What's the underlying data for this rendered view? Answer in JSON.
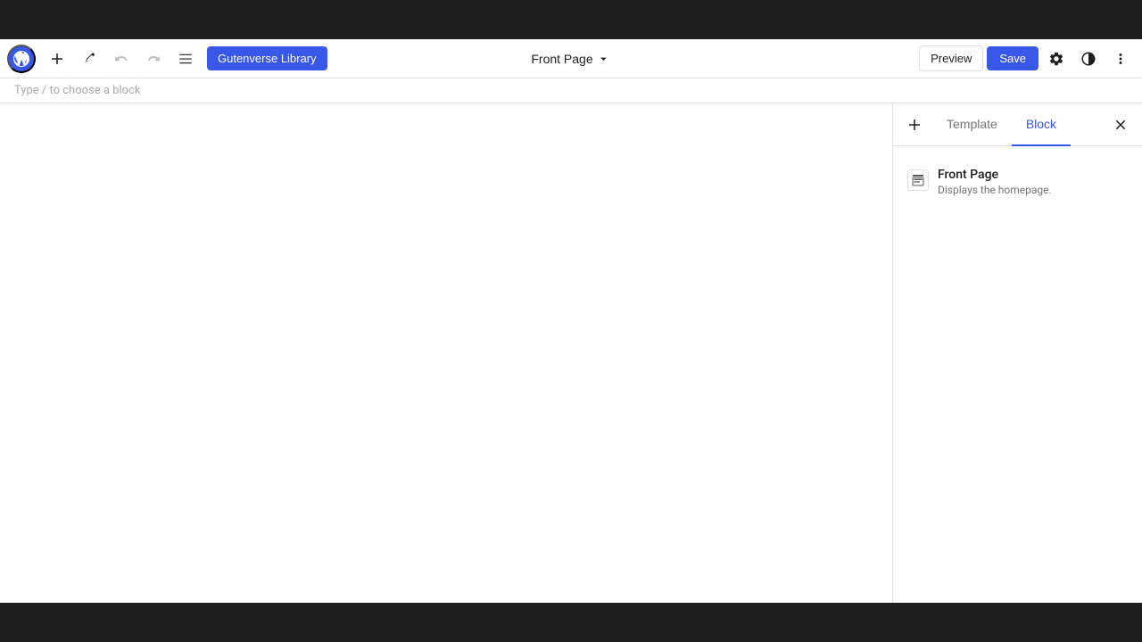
{
  "topBar": {
    "bg": "#1e1e1e"
  },
  "toolbar": {
    "wpLogo": "wordpress-logo",
    "addLabel": "+",
    "editLabel": "✏",
    "undoLabel": "↩",
    "redoLabel": "↪",
    "listLabel": "≡",
    "gutenverseLabel": "Gutenverse Library",
    "pageTitle": "Front Page",
    "previewLabel": "Preview",
    "saveLabel": "Save"
  },
  "hintBar": {
    "placeholder": "Type / to choose a block"
  },
  "sidebar": {
    "addLabel": "+",
    "tabs": [
      {
        "label": "Template",
        "active": false
      },
      {
        "label": "Block",
        "active": true
      }
    ],
    "closeLabel": "×",
    "template": {
      "name": "Front Page",
      "description": "Displays the homepage."
    }
  },
  "bottomBar": {
    "bg": "#1e1e1e"
  }
}
